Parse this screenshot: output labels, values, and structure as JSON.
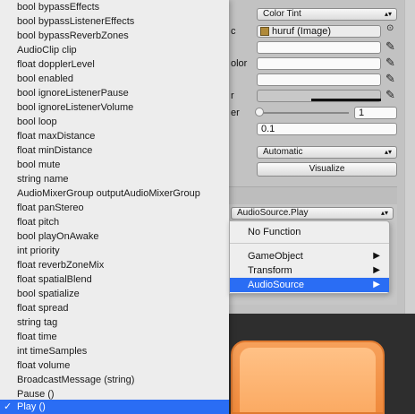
{
  "inspector": {
    "transition_value": "Color Tint",
    "target_graphic_value": "huruf (Image)",
    "label_fragment_c": "c",
    "label_fragment_olor": "olor",
    "label_fragment_r": "r",
    "label_fragment_er": "er",
    "slider_value": "1",
    "fade_duration_value": "0.1",
    "navigation_value": "Automatic",
    "visualize_label": "Visualize",
    "event_function_value": "AudioSource.Play"
  },
  "menu": {
    "items": [
      "bool bypassEffects",
      "bool bypassListenerEffects",
      "bool bypassReverbZones",
      "AudioClip clip",
      "float dopplerLevel",
      "bool enabled",
      "bool ignoreListenerPause",
      "bool ignoreListenerVolume",
      "bool loop",
      "float maxDistance",
      "float minDistance",
      "bool mute",
      "string name",
      "AudioMixerGroup outputAudioMixerGroup",
      "float panStereo",
      "float pitch",
      "bool playOnAwake",
      "int priority",
      "float reverbZoneMix",
      "float spatialBlend",
      "bool spatialize",
      "float spread",
      "string tag",
      "float time",
      "int timeSamples",
      "float volume",
      "BroadcastMessage (string)",
      "Pause ()",
      "Play ()"
    ],
    "checkmark": "✓"
  },
  "submenu": {
    "no_function": "No Function",
    "game_object": "GameObject",
    "transform": "Transform",
    "audio_source": "AudioSource",
    "arrow": "▶"
  },
  "colors": {
    "selection": "#2a6df4",
    "accent_orange": "#f08a3c"
  }
}
